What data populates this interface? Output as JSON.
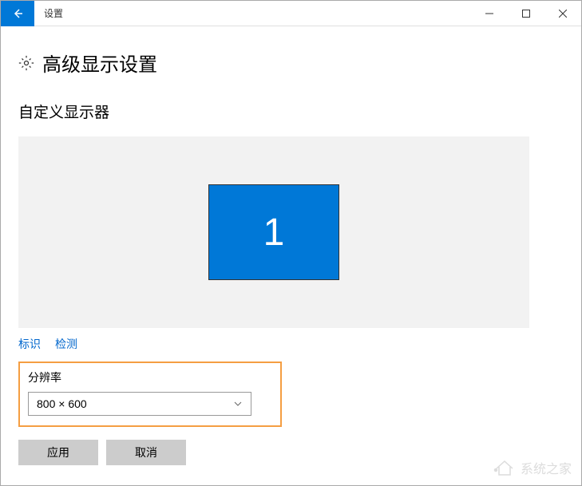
{
  "titlebar": {
    "title": "设置"
  },
  "page": {
    "title": "高级显示设置",
    "section_title": "自定义显示器"
  },
  "display": {
    "monitor_number": "1"
  },
  "links": {
    "identify": "标识",
    "detect": "检测"
  },
  "resolution": {
    "label": "分辨率",
    "value": "800 × 600"
  },
  "buttons": {
    "apply": "应用",
    "cancel": "取消"
  },
  "watermark": {
    "text": "系统之家"
  }
}
